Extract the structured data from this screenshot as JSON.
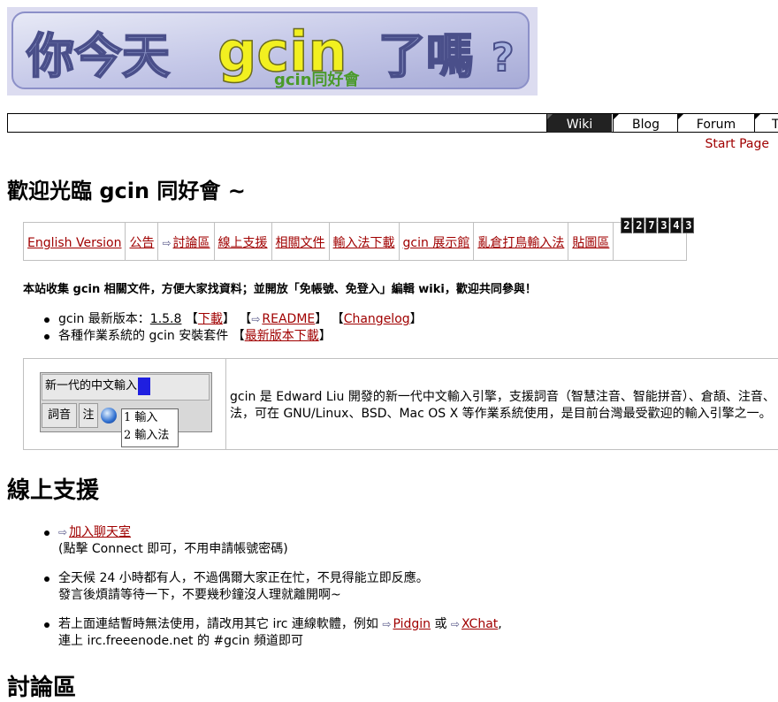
{
  "logo": {
    "main_text": "你今天 gcin 了嗎？",
    "sub_text": "gcin同好會",
    "brand_text": "gcin",
    "title_left": "你今天",
    "title_right": "了嗎"
  },
  "nav": {
    "tabs": [
      "Wiki",
      "Blog",
      "Forum",
      "T"
    ],
    "start_page": "Start Page"
  },
  "welcome_heading": "歡迎光臨 gcin 同好會 ~",
  "linkbar": {
    "items": [
      "English Version",
      "公告",
      "討論區",
      "線上支援",
      "相關文件",
      "輸入法下載",
      "gcin 展示館",
      "亂倉打鳥輸入法",
      "貼圖區"
    ],
    "counter": [
      "2",
      "2",
      "7",
      "3",
      "4",
      "3"
    ]
  },
  "intro": "本站收集 gcin 相關文件，方便大家找資料；並開放「免帳號、免登入」編輯 wiki，歡迎共同參與！",
  "release": {
    "version_prefix": "gcin 最新版本：",
    "version": "1.5.8",
    "download": "下載",
    "readme": "README",
    "changelog": "Changelog",
    "packages_prefix": "各種作業系統的 gcin 安裝套件",
    "latest_download": "最新版本下載"
  },
  "ime_demo": {
    "input_text": "新一代的中文輸入",
    "btn1": "詞音",
    "btn2": "注",
    "cand1": "1 輸入",
    "cand2": "2 輸入法"
  },
  "feature_desc": {
    "line1": "gcin 是 Edward Liu 開發的新一代中文輸入引擎，支援詞音（智慧注音、智能拼音）、倉頡、注音、",
    "line2": "法，可在 GNU/Linux、BSD、Mac OS X 等作業系統使用，是目前台灣最受歡迎的輸入引擎之一。"
  },
  "support": {
    "heading": "線上支援",
    "chat_link": "加入聊天室",
    "chat_note": "(點擊 Connect 即可，不用申請帳號密碼)",
    "line2a": "全天候 24 小時都有人，不過偶爾大家正在忙，不見得能立即反應。",
    "line2b": "發言後煩請等待一下，不要幾秒鐘沒人理就離開啊~",
    "line3a_pre": "若上面連結暫時無法使用，請改用其它 irc 連線軟體，例如",
    "pidgin": "Pidgin",
    "or": "或",
    "xchat": "XChat",
    "line3b": "連上 irc.freeenode.net 的 #gcin 頻道即可"
  },
  "forum_heading": "討論區",
  "colors": {
    "link": "#a00000",
    "nav_active": "#222222",
    "caret": "#1f1fe0",
    "border": "#c0c0c0"
  }
}
